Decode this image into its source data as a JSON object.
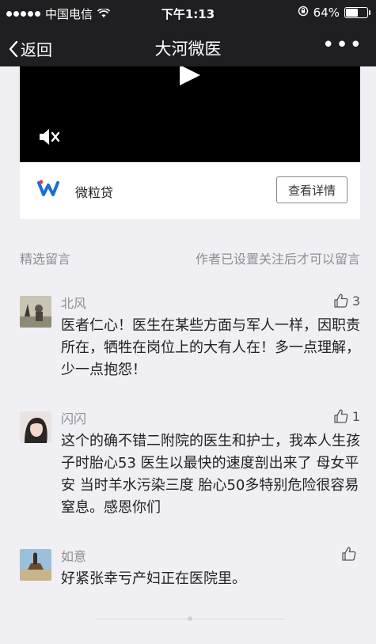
{
  "status_bar": {
    "carrier": "中国电信",
    "time": "下午1:13",
    "battery": "64%",
    "battery_level": 0.64
  },
  "nav": {
    "back_label": "返回",
    "title": "大河微医",
    "more": "•••"
  },
  "video": {
    "play_icon": "play-icon",
    "mute_icon": "speaker-muted-icon"
  },
  "ad": {
    "logo_icon": "w-logo-icon",
    "name": "微粒贷",
    "button_label": "查看详情",
    "logo_color": "#1a6fd8"
  },
  "comments_section": {
    "title": "精选留言",
    "note": "作者已设置关注后才可以留言"
  },
  "comments": [
    {
      "name": "北风",
      "likes": "3",
      "text": "医者仁心！医生在某些方面与军人一样，因职责所在，牺牲在岗位上的大有人在！多一点理解，少一点抱怨！"
    },
    {
      "name": "闪闪",
      "likes": "1",
      "text": "这个的确不错二附院的医生和护士，我本人生孩子时胎心53 医生以最快的速度剖出来了 母女平安 当时羊水污染三度 胎心50多特别危险很容易窒息。感恩你们"
    },
    {
      "name": "如意",
      "likes": "",
      "text": "好紧张幸亏产妇正在医院里。"
    }
  ]
}
